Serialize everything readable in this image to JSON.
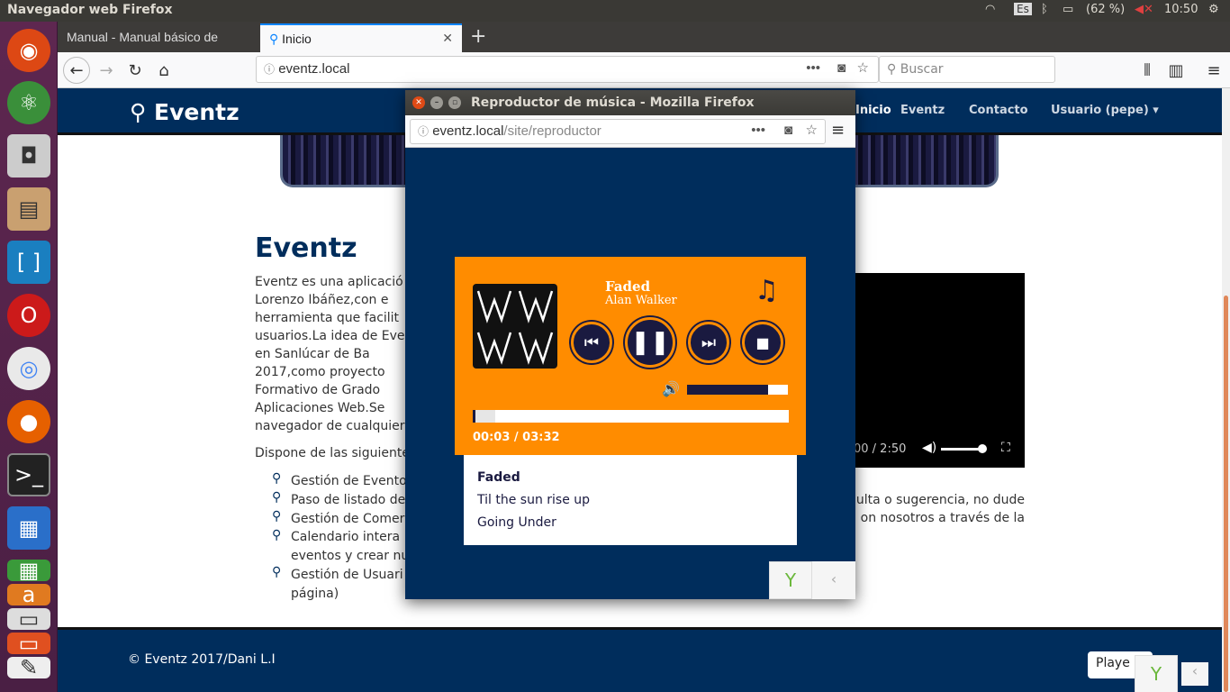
{
  "topbar": {
    "title": "Navegador web Firefox",
    "lang": "Es",
    "battery": "(62 %)",
    "time": "10:50"
  },
  "browser": {
    "tabs": [
      {
        "label": "Manual - Manual básico de"
      },
      {
        "label": "Inicio"
      }
    ],
    "url": "eventz.local",
    "search_placeholder": "Buscar"
  },
  "site": {
    "brand": "Eventz",
    "nav": [
      "Inicio",
      "Eventz",
      "Contacto",
      "Usuario (pepe) ▾"
    ],
    "heading": "Eventz",
    "para_lines": [
      "Eventz es una aplicació",
      "Lorenzo Ibáñez,con e",
      "herramienta que facilit",
      "usuarios.La idea de Eve",
      "en Sanlúcar de Ba",
      "2017,como proyecto",
      "Formativo de Grado",
      "Aplicaciones Web.Se",
      "navegador de cualquier"
    ],
    "features_intro": "Dispone de las siguiente",
    "features": [
      "Gestión de Evento",
      "Paso de listado de",
      "Gestión de Comer",
      "Calendario intera",
      "eventos y crear nu",
      "Gestión de Usuari",
      "página)"
    ],
    "right_text": [
      "ulta o sugerencia, no dude",
      "on nosotros a través de la"
    ],
    "video_time": "00 / 2:50",
    "footer": "© Eventz 2017/Dani L.I",
    "player_button": "Playe"
  },
  "popup": {
    "title": "Reproductor de música - Mozilla Firefox",
    "url_host": "eventz.local",
    "url_path": "/site/reproductor",
    "player": {
      "song": "Faded",
      "artist": "Alan Walker",
      "time": "00:03 / 03:32",
      "progress": 0.07,
      "volume": 0.8
    },
    "playlist": [
      "Faded",
      "Til the sun rise up",
      "Going Under"
    ]
  },
  "colors": {
    "navy": "#002d5c",
    "orange": "#ff8c00"
  }
}
